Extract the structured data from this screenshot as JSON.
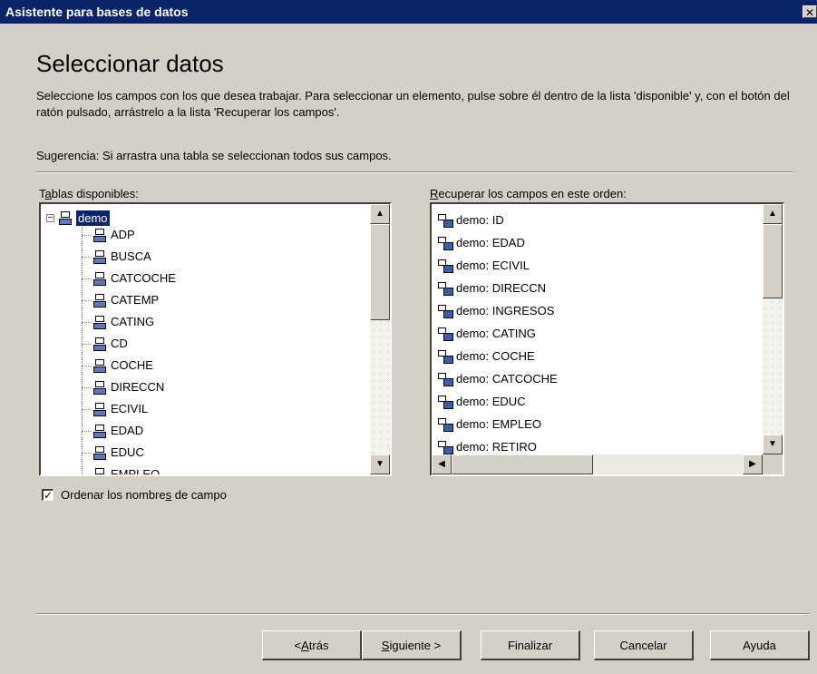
{
  "window": {
    "title": "Asistente para bases de datos",
    "close_glyph": "✕"
  },
  "page": {
    "heading": "Seleccionar datos",
    "description": "Seleccione los campos con los que desea trabajar. Para seleccionar un elemento, pulse sobre él dentro de la lista 'disponible' y, con el botón del ratón pulsado, arrástrelo a la lista 'Recuperar los campos'.",
    "hint": "Sugerencia: Si arrastra una tabla se seleccionan todos sus campos."
  },
  "available": {
    "label_pre": "T",
    "label_accel": "a",
    "label_post": "blas disponibles:",
    "root": "demo",
    "items": [
      "ADP",
      "BUSCA",
      "CATCOCHE",
      "CATEMP",
      "CATING",
      "CD",
      "COCHE",
      "DIRECCN",
      "ECIVIL",
      "EDAD",
      "EDUC",
      "EMPLEO"
    ]
  },
  "retrieve": {
    "label_accel": "R",
    "label_post": "ecuperar los campos en este orden:",
    "items": [
      "demo: ID",
      "demo: EDAD",
      "demo: ECIVIL",
      "demo: DIRECCN",
      "demo: INGRESOS",
      "demo: CATING",
      "demo: COCHE",
      "demo: CATCOCHE",
      "demo: EDUC",
      "demo: EMPLEO",
      "demo: RETIRO"
    ]
  },
  "sort_option": {
    "checked": true,
    "label_pre": "Ordenar los nombre",
    "label_accel": "s",
    "label_post": " de campo"
  },
  "buttons": {
    "back_pre": "< ",
    "back_accel": "A",
    "back_post": "trás",
    "next_accel": "S",
    "next_post": "iguiente >",
    "finish": "Finalizar",
    "cancel": "Cancelar",
    "help": "Ayuda"
  }
}
